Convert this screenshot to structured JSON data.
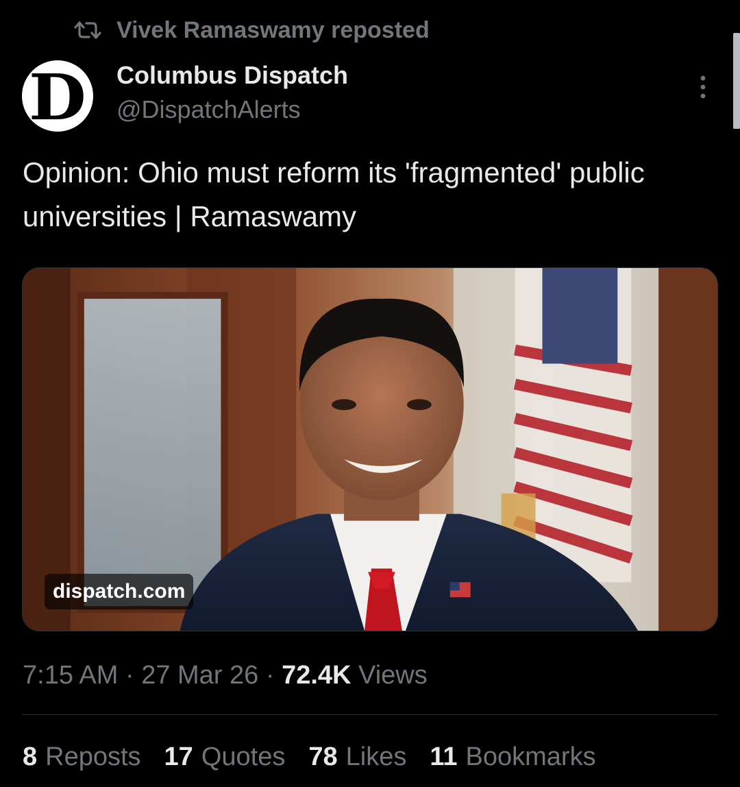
{
  "repost": {
    "text": "Vivek Ramaswamy reposted",
    "icon": "repost-icon"
  },
  "author": {
    "name": "Columbus Dispatch",
    "handle": "@DispatchAlerts",
    "avatar_letter": "D"
  },
  "more_icon": "more-options-icon",
  "tweet": {
    "text": "Opinion: Ohio must reform its 'fragmented' public universities | Ramaswamy"
  },
  "media": {
    "domain": "dispatch.com"
  },
  "meta": {
    "time": "7:15 AM",
    "separator_1": " · ",
    "date": "27 Mar 26",
    "separator_2": " · ",
    "views_count": "72.4K",
    "views_label": " Views"
  },
  "stats": [
    {
      "count": "8",
      "label": "Reposts"
    },
    {
      "count": "17",
      "label": "Quotes"
    },
    {
      "count": "78",
      "label": "Likes"
    },
    {
      "count": "11",
      "label": "Bookmarks"
    }
  ],
  "colors": {
    "background": "#000000",
    "primary_text": "#e7e9ea",
    "secondary_text": "#71767b",
    "divider": "#2f3336"
  }
}
